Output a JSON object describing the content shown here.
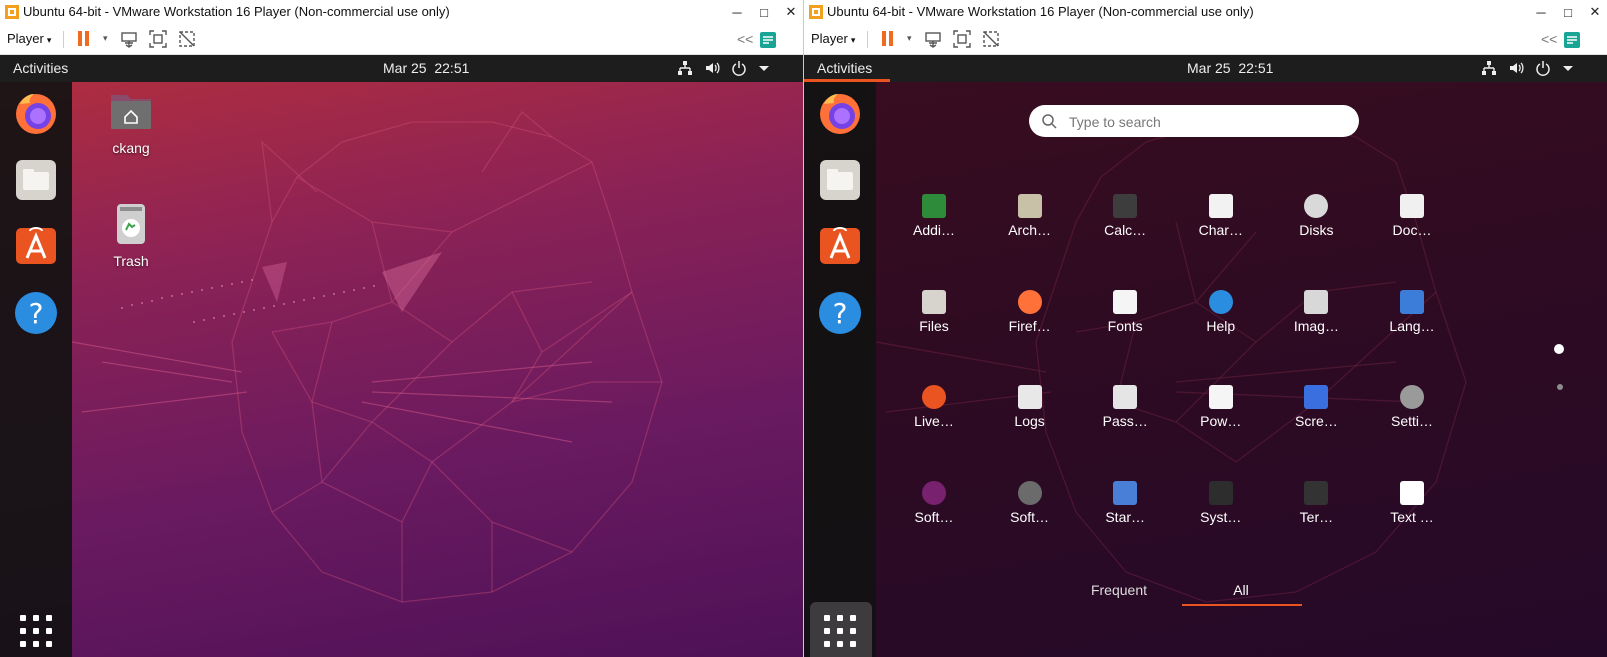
{
  "window": {
    "title": "Ubuntu 64-bit - VMware Workstation 16 Player (Non-commercial use only)",
    "controls": {
      "minimize": "─",
      "maximize": "□",
      "close": "✕"
    }
  },
  "toolbar": {
    "player_label": "Player",
    "caret": "▾",
    "collapse_glyph": "<<"
  },
  "topbar": {
    "activities": "Activities",
    "date": "Mar 25",
    "time": "22:51"
  },
  "dock": {
    "items": [
      {
        "name": "Firefox",
        "icon": "firefox-icon"
      },
      {
        "name": "Files",
        "icon": "files-icon"
      },
      {
        "name": "Ubuntu Software",
        "icon": "software-icon"
      },
      {
        "name": "Help",
        "icon": "help-icon"
      }
    ],
    "apps_button_icon": "grid-icon"
  },
  "desktop": {
    "icons": [
      {
        "label": "ckang",
        "icon": "home-folder-icon"
      },
      {
        "label": "Trash",
        "icon": "trash-icon"
      }
    ]
  },
  "overview": {
    "search_placeholder": "Type to search",
    "apps": [
      {
        "label": "Addi…",
        "icon": "chip-icon"
      },
      {
        "label": "Arch…",
        "icon": "archive-icon"
      },
      {
        "label": "Calc…",
        "icon": "calculator-icon"
      },
      {
        "label": "Char…",
        "icon": "characters-icon"
      },
      {
        "label": "Disks",
        "icon": "disks-icon"
      },
      {
        "label": "Doc…",
        "icon": "document-viewer-icon"
      },
      {
        "label": "Files",
        "icon": "files-icon"
      },
      {
        "label": "Firef…",
        "icon": "firefox-icon"
      },
      {
        "label": "Fonts",
        "icon": "fonts-icon"
      },
      {
        "label": "Help",
        "icon": "help-icon"
      },
      {
        "label": "Imag…",
        "icon": "image-viewer-icon"
      },
      {
        "label": "Lang…",
        "icon": "language-icon"
      },
      {
        "label": "Live…",
        "icon": "livepatch-icon"
      },
      {
        "label": "Logs",
        "icon": "logs-icon"
      },
      {
        "label": "Pass…",
        "icon": "passwords-icon"
      },
      {
        "label": "Pow…",
        "icon": "power-statistics-icon"
      },
      {
        "label": "Scre…",
        "icon": "screenshot-icon"
      },
      {
        "label": "Setti…",
        "icon": "settings-icon"
      },
      {
        "label": "Soft…",
        "icon": "software-updater-icon"
      },
      {
        "label": "Soft…",
        "icon": "software-properties-icon"
      },
      {
        "label": "Star…",
        "icon": "startup-disk-icon"
      },
      {
        "label": "Syst…",
        "icon": "system-monitor-icon"
      },
      {
        "label": "Ter…",
        "icon": "terminal-icon"
      },
      {
        "label": "Text …",
        "icon": "text-editor-icon"
      }
    ],
    "tabs": {
      "frequent": "Frequent",
      "all": "All"
    }
  },
  "colors": {
    "accent": "#e95420",
    "topbar": "#1d1d1d",
    "dock": "#121212"
  }
}
